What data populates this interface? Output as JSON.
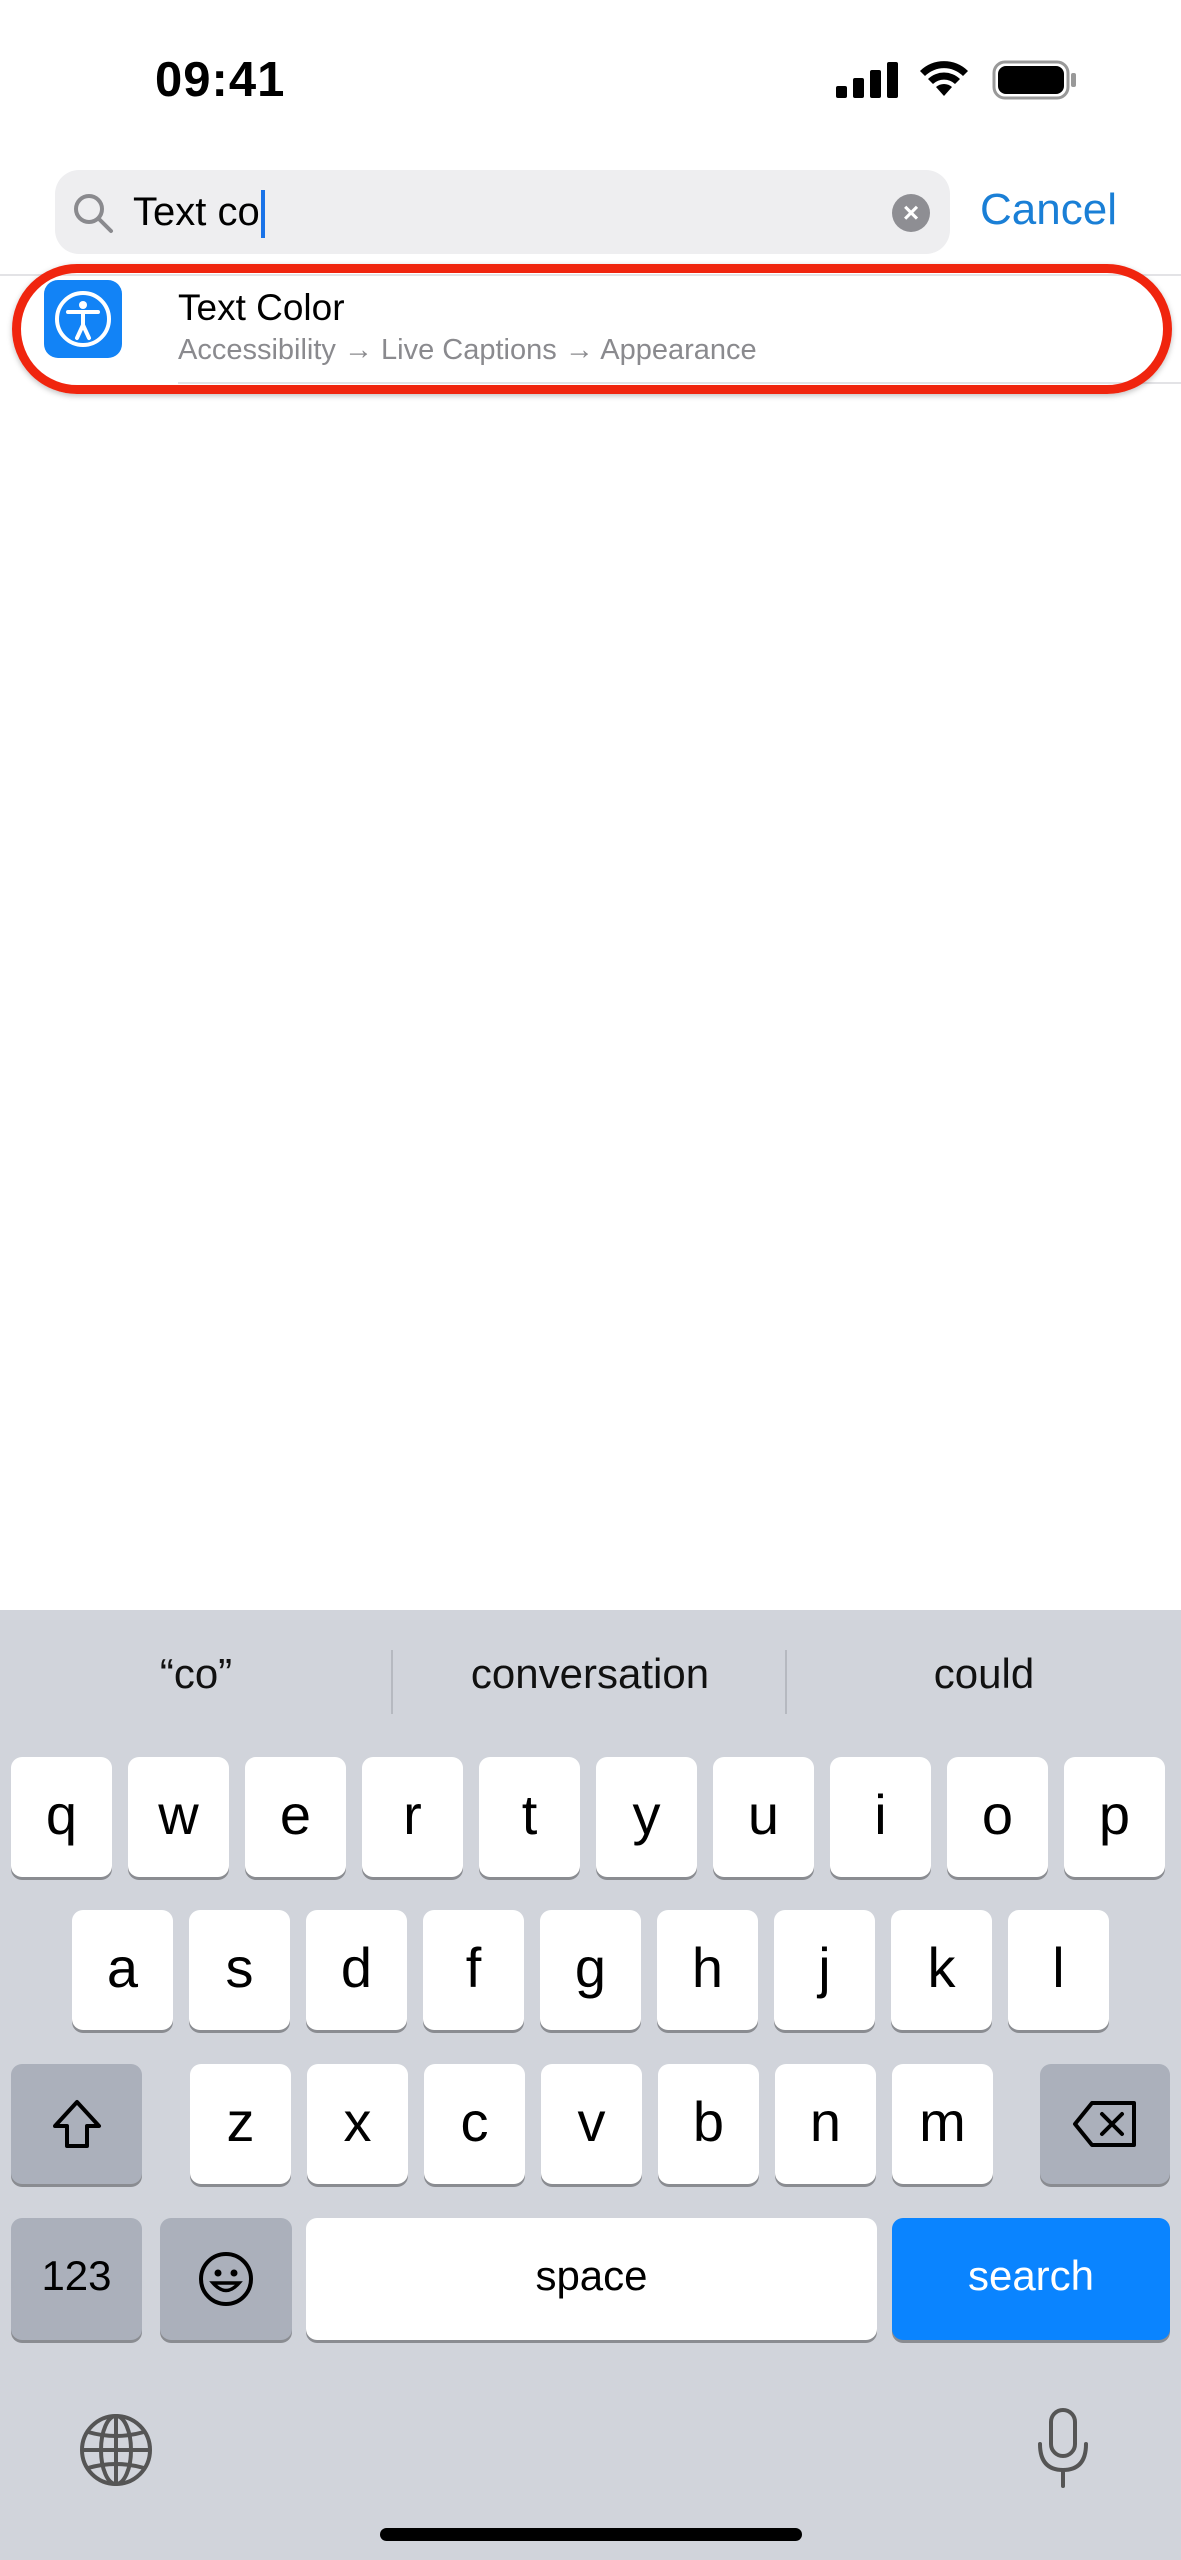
{
  "status_bar": {
    "time": "09:41",
    "signal-icon": "cellular-bars",
    "wifi-icon": "wifi",
    "battery-icon": "battery-full"
  },
  "search": {
    "query": "Text co",
    "cancel_label": "Cancel",
    "search-icon": "magnifying-glass",
    "clear-icon": "x-circle"
  },
  "results": [
    {
      "title": "Text Color",
      "path": "Accessibility → Live Captions → Appearance",
      "icon": "accessibility",
      "icon_color": "#1283f6"
    }
  ],
  "highlight_color": "#f0250e",
  "keyboard": {
    "suggestions": [
      "“co”",
      "conversation",
      "could"
    ],
    "row1": [
      "q",
      "w",
      "e",
      "r",
      "t",
      "y",
      "u",
      "i",
      "o",
      "p"
    ],
    "row2": [
      "a",
      "s",
      "d",
      "f",
      "g",
      "h",
      "j",
      "k",
      "l"
    ],
    "row3": [
      "z",
      "x",
      "c",
      "v",
      "b",
      "n",
      "m"
    ],
    "numbers_label": "123",
    "space_label": "space",
    "search_label": "search",
    "accent": "#0a84ff"
  }
}
